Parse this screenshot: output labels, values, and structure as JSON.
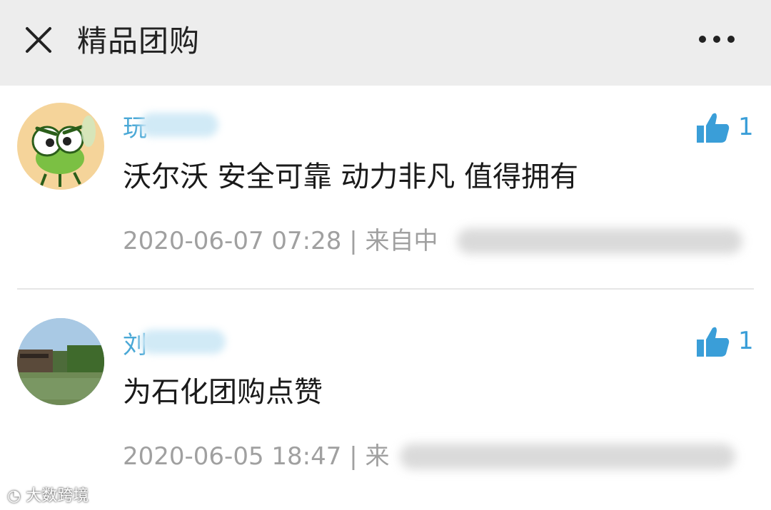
{
  "header": {
    "title": "精品团购"
  },
  "comments": [
    {
      "name_visible": "玩",
      "text": "沃尔沃 安全可靠 动力非凡 值得拥有",
      "date": "2020-06-07 07:28",
      "source_prefix": "| 来自中",
      "likes": "1"
    },
    {
      "name_visible": "刘",
      "text": "为石化团购点赞",
      "date": "2020-06-05 18:47",
      "source_prefix": "| 来",
      "likes": "1"
    }
  ],
  "watermark": "大数跨境",
  "colors": {
    "header_bg": "#ededed",
    "name": "#4aa8d6",
    "like": "#3a9ed8",
    "meta": "#a0a0a0"
  }
}
